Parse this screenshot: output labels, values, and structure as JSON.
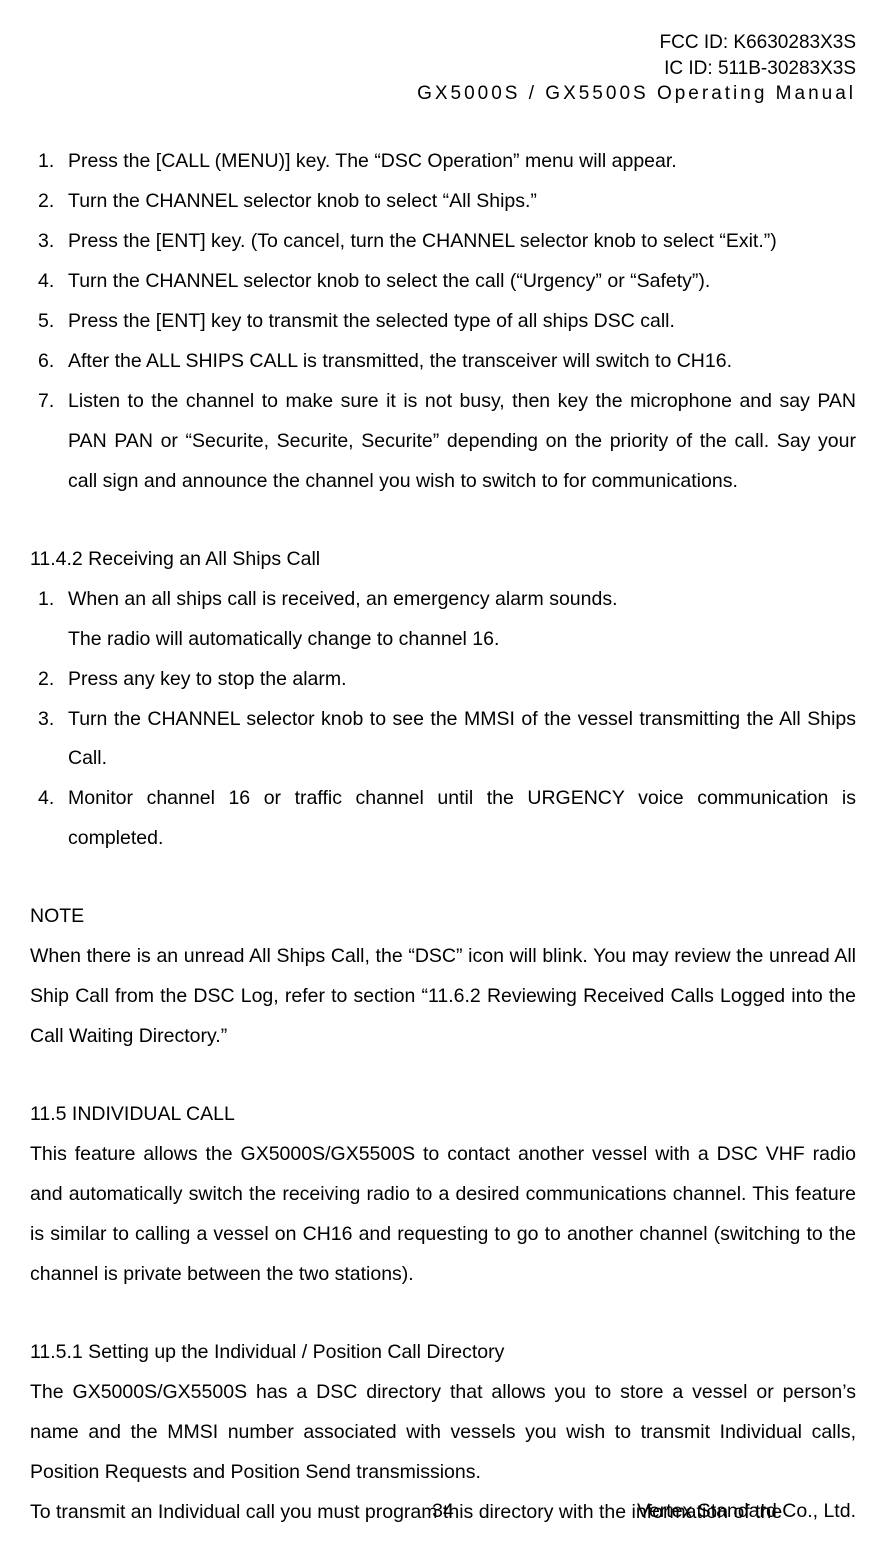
{
  "header": {
    "line1": "FCC ID: K6630283X3S",
    "line2": "IC ID: 511B-30283X3S",
    "line3": "GX5000S / GX5500S  Operating Manual"
  },
  "list_a": {
    "items": [
      {
        "num": "1.",
        "text": "Press the [CALL (MENU)] key. The “DSC Operation” menu will appear."
      },
      {
        "num": "2.",
        "text": "Turn the CHANNEL selector knob to select “All Ships.”"
      },
      {
        "num": "3.",
        "text": "Press the [ENT] key. (To cancel, turn the CHANNEL selector knob to select “Exit.”)"
      },
      {
        "num": "4.",
        "text": "Turn the CHANNEL selector knob to select the call (“Urgency” or “Safety”)."
      },
      {
        "num": "5.",
        "text": "Press the [ENT] key to transmit the selected type of all ships DSC call."
      },
      {
        "num": "6.",
        "text": "After the ALL SHIPS CALL is transmitted, the transceiver will switch to CH16."
      },
      {
        "num": "7.",
        "text": "Listen to the channel to make sure it is not busy, then key the microphone and say PAN PAN PAN or “Securite, Securite, Securite” depending on the priority of the call. Say your call sign and announce the channel you wish to switch to for communications."
      }
    ]
  },
  "section_b": {
    "heading": "11.4.2 Receiving an All Ships Call",
    "items": [
      {
        "num": "1.",
        "text": "When an all ships call is received, an emergency alarm sounds.",
        "cont": "The radio will automatically change to channel 16."
      },
      {
        "num": "2.",
        "text": "Press any key to stop the alarm."
      },
      {
        "num": "3.",
        "text": "Turn the CHANNEL selector knob to see the MMSI of the vessel transmitting the All Ships Call."
      },
      {
        "num": "4.",
        "text": "Monitor channel 16 or traffic channel until the URGENCY voice communication is completed."
      }
    ]
  },
  "note": {
    "heading": "NOTE",
    "body": "When there is an unread All Ships Call, the “DSC” icon will blink. You may review the unread All Ship Call from the DSC Log, refer to section “11.6.2 Reviewing Received Calls Logged into the Call Waiting Directory.”"
  },
  "section_c": {
    "heading": "11.5 INDIVIDUAL CALL",
    "body": "This feature allows the GX5000S/GX5500S to contact another vessel with a DSC VHF radio and automatically switch the receiving radio to a desired communications channel. This feature is similar to calling a vessel on CH16 and requesting to go to another channel (switching to the channel is private between the two stations)."
  },
  "section_d": {
    "heading": "11.5.1 Setting up the Individual / Position Call Directory",
    "body1": "The GX5000S/GX5500S has a DSC directory that allows you to store a vessel or person’s name and the MMSI number associated with vessels you wish to transmit Individual calls, Position Requests and Position Send transmissions.",
    "body2": "To transmit an Individual call you must program this directory with the information of the"
  },
  "footer": {
    "page": "34",
    "company": "Vertex Standard Co., Ltd."
  }
}
